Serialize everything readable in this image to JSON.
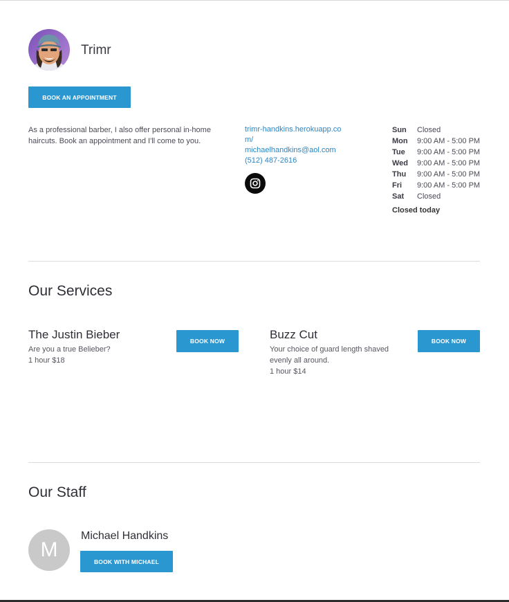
{
  "header": {
    "business_name": "Trimr",
    "book_button_label": "BOOK AN APPOINTMENT"
  },
  "about": {
    "text": "As a professional barber, I also offer personal in-home haircuts. Book an appointment and I'll come to you."
  },
  "contact": {
    "website": "trimr-handkins.herokuapp.com/",
    "email": "michaelhandkins@aol.com",
    "phone": "(512) 487-2616",
    "social_icon": "instagram-icon"
  },
  "hours": {
    "days": [
      {
        "day": "Sun",
        "time": "Closed"
      },
      {
        "day": "Mon",
        "time": "9:00 AM - 5:00 PM"
      },
      {
        "day": "Tue",
        "time": "9:00 AM - 5:00 PM"
      },
      {
        "day": "Wed",
        "time": "9:00 AM - 5:00 PM"
      },
      {
        "day": "Thu",
        "time": "9:00 AM - 5:00 PM"
      },
      {
        "day": "Fri",
        "time": "9:00 AM - 5:00 PM"
      },
      {
        "day": "Sat",
        "time": "Closed"
      }
    ],
    "status": "Closed today"
  },
  "services": {
    "title": "Our Services",
    "items": [
      {
        "name": "The Justin Bieber",
        "description": "Are you a true Belieber?",
        "meta": "1 hour $18",
        "button_label": "BOOK NOW"
      },
      {
        "name": "Buzz Cut",
        "description": "Your choice of guard length shaved evenly all around.",
        "meta": "1 hour $14",
        "button_label": "BOOK NOW"
      }
    ]
  },
  "staff": {
    "title": "Our Staff",
    "members": [
      {
        "initial": "M",
        "name": "Michael Handkins",
        "button_label": "BOOK WITH MICHAEL"
      }
    ]
  },
  "colors": {
    "accent": "#2b97d1",
    "link": "#2b86c5",
    "text": "#3d3d45"
  }
}
